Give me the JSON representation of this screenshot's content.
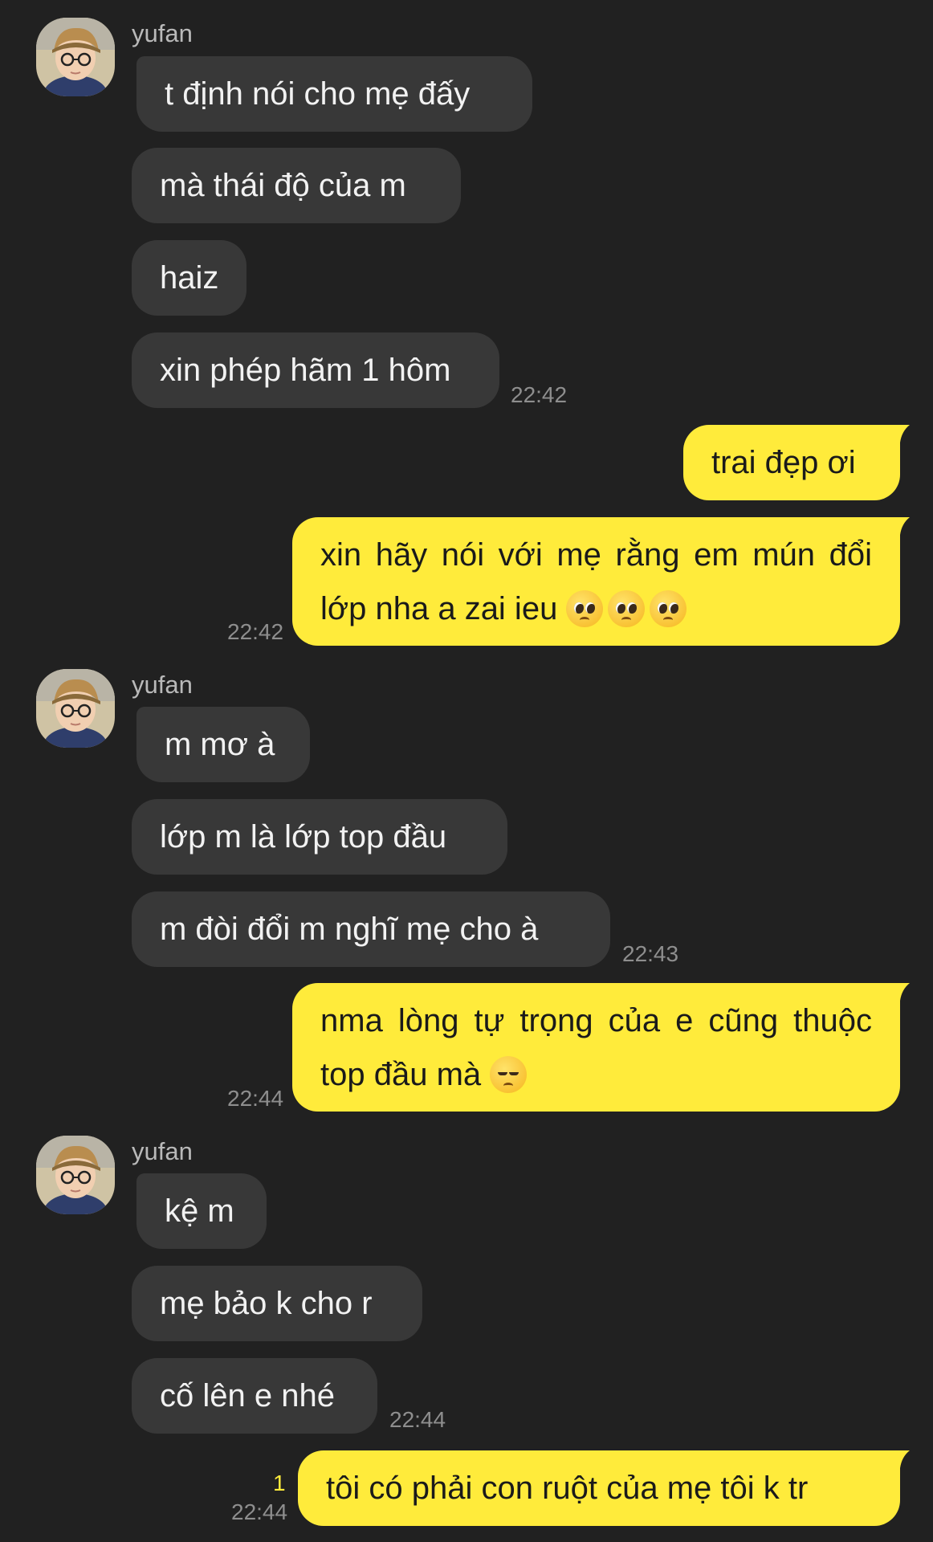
{
  "contact": {
    "name": "yufan"
  },
  "colors": {
    "background": "#212121",
    "incoming_bubble": "#383838",
    "outgoing_bubble": "#ffeb3b",
    "timestamp": "#8e8e8e"
  },
  "messages": [
    {
      "text": "t định nói cho mẹ đấy"
    },
    {
      "text": "mà thái độ của m"
    },
    {
      "text": "haiz"
    },
    {
      "text": "xin phép hãm 1 hôm",
      "time": "22:42"
    },
    {
      "text": "trai đẹp ơi"
    },
    {
      "text": "xin hãy nói với mẹ rằng em mún đổi lớp nha a zai ieu",
      "emoji": "pleading-face-emoji x3",
      "time": "22:42"
    },
    {
      "text": "m mơ à"
    },
    {
      "text": "lớp m là lớp top đầu"
    },
    {
      "text": "m đòi đổi m nghĩ mẹ cho à",
      "time": "22:43"
    },
    {
      "text": "nma lòng tự trọng của e cũng thuộc top đầu mà",
      "emoji": "pensive-face-emoji",
      "time": "22:44"
    },
    {
      "text": "kệ m"
    },
    {
      "text": "mẹ bảo k cho r"
    },
    {
      "text": "cố lên e nhé",
      "time": "22:44"
    },
    {
      "text": "tôi có phải con ruột của mẹ tôi k tr",
      "time": "22:44",
      "unread_count": "1"
    }
  ]
}
